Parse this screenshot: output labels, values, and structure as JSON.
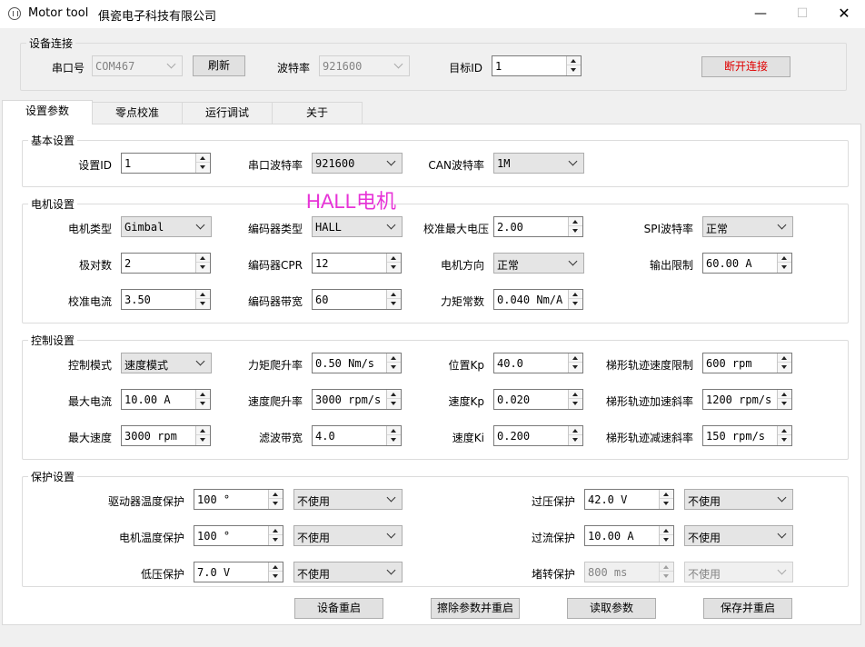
{
  "window": {
    "title": "Motor tool",
    "company": "俱瓷电子科技有限公司",
    "min_icon": "minimize-icon",
    "max_icon": "maximize-icon",
    "close_icon": "close-icon"
  },
  "connection": {
    "title": "设备连接",
    "port_label": "串口号",
    "port_value": "COM467",
    "refresh_label": "刷新",
    "baud_label": "波特率",
    "baud_value": "921600",
    "target_id_label": "目标ID",
    "target_id_value": "1",
    "disconnect_label": "断开连接",
    "disconnect_color": "#e00000"
  },
  "tabs": [
    {
      "label": "设置参数",
      "active": true
    },
    {
      "label": "零点校准",
      "active": false
    },
    {
      "label": "运行调试",
      "active": false
    },
    {
      "label": "关于",
      "active": false
    }
  ],
  "basic": {
    "title": "基本设置",
    "device_id_label": "设置ID",
    "device_id_value": "1",
    "serial_baud_label": "串口波特率",
    "serial_baud_value": "921600",
    "can_baud_label": "CAN波特率",
    "can_baud_value": "1M"
  },
  "motor": {
    "title": "电机设置",
    "overlay_text": "HALL电机",
    "overlay_color": "#e733d7",
    "motor_type_label": "电机类型",
    "motor_type_value": "Gimbal",
    "encoder_type_label": "编码器类型",
    "encoder_type_value": "HALL",
    "cal_max_voltage_label": "校准最大电压",
    "cal_max_voltage_value": "2.00",
    "spi_baud_label": "SPI波特率",
    "spi_baud_value": "正常",
    "pole_pairs_label": "极对数",
    "pole_pairs_value": "2",
    "encoder_cpr_label": "编码器CPR",
    "encoder_cpr_value": "12",
    "motor_dir_label": "电机方向",
    "motor_dir_value": "正常",
    "output_limit_label": "输出限制",
    "output_limit_value": "60.00 A",
    "cal_current_label": "校准电流",
    "cal_current_value": "3.50",
    "encoder_bw_label": "编码器带宽",
    "encoder_bw_value": "60",
    "torque_const_label": "力矩常数",
    "torque_const_value": "0.040 Nm/A"
  },
  "control": {
    "title": "控制设置",
    "mode_label": "控制模式",
    "mode_value": "速度模式",
    "torque_ramp_label": "力矩爬升率",
    "torque_ramp_value": "0.50 Nm/s",
    "pos_kp_label": "位置Kp",
    "pos_kp_value": "40.0",
    "traj_vel_label": "梯形轨迹速度限制",
    "traj_vel_value": "600 rpm",
    "max_current_label": "最大电流",
    "max_current_value": "10.00 A",
    "vel_ramp_label": "速度爬升率",
    "vel_ramp_value": "3000 rpm/s",
    "vel_kp_label": "速度Kp",
    "vel_kp_value": "0.020",
    "traj_accel_label": "梯形轨迹加速斜率",
    "traj_accel_value": "1200 rpm/s",
    "max_speed_label": "最大速度",
    "max_speed_value": "3000 rpm",
    "filter_bw_label": "滤波带宽",
    "filter_bw_value": "4.0",
    "vel_ki_label": "速度Ki",
    "vel_ki_value": "0.200",
    "traj_decel_label": "梯形轨迹减速斜率",
    "traj_decel_value": "150 rpm/s"
  },
  "protection": {
    "title": "保护设置",
    "driver_temp_label": "驱动器温度保护",
    "driver_temp_value": "100 °",
    "driver_temp_mode": "不使用",
    "motor_temp_label": "电机温度保护",
    "motor_temp_value": "100 °",
    "motor_temp_mode": "不使用",
    "undervolt_label": "低压保护",
    "undervolt_value": "7.0 V",
    "undervolt_mode": "不使用",
    "overvolt_label": "过压保护",
    "overvolt_value": "42.0 V",
    "overvolt_mode": "不使用",
    "overcurrent_label": "过流保护",
    "overcurrent_value": "10.00 A",
    "overcurrent_mode": "不使用",
    "stall_label": "堵转保护",
    "stall_value": "800 ms",
    "stall_mode": "不使用"
  },
  "actions": {
    "reboot_label": "设备重启",
    "erase_label": "擦除参数并重启",
    "read_label": "读取参数",
    "save_label": "保存并重启"
  }
}
